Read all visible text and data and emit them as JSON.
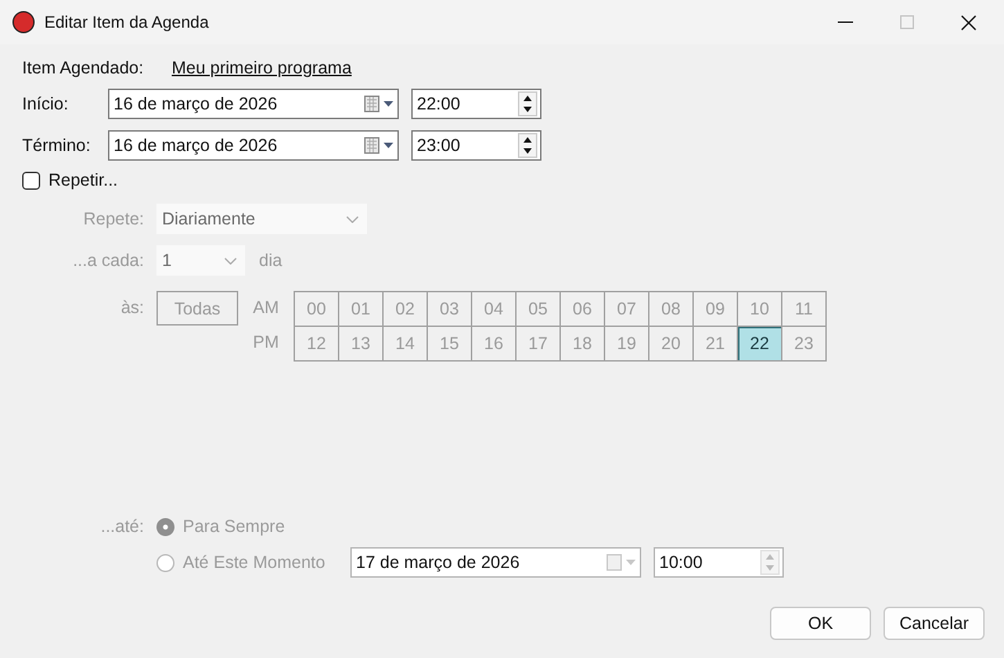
{
  "window": {
    "title": "Editar Item da Agenda",
    "maximize_enabled": false
  },
  "item": {
    "label": "Item Agendado:",
    "link": "Meu primeiro programa"
  },
  "start": {
    "label": "Início:",
    "date": "16 de março de 2026",
    "time": "22:00"
  },
  "end": {
    "label": "Término:",
    "date": "16 de março de 2026",
    "time": "23:00"
  },
  "repeat": {
    "label": "Repetir...",
    "checked": false
  },
  "repeat_mode": {
    "label": "Repete:",
    "value": "Diariamente"
  },
  "interval": {
    "label": "...a cada:",
    "value": "1",
    "unit": "dia"
  },
  "at": {
    "label": "às:",
    "all_button": "Todas",
    "rows": [
      {
        "label": "AM",
        "hours": [
          {
            "label": "00",
            "selected": false
          },
          {
            "label": "01",
            "selected": false
          },
          {
            "label": "02",
            "selected": false
          },
          {
            "label": "03",
            "selected": false
          },
          {
            "label": "04",
            "selected": false
          },
          {
            "label": "05",
            "selected": false
          },
          {
            "label": "06",
            "selected": false
          },
          {
            "label": "07",
            "selected": false
          },
          {
            "label": "08",
            "selected": false
          },
          {
            "label": "09",
            "selected": false
          },
          {
            "label": "10",
            "selected": false
          },
          {
            "label": "11",
            "selected": false
          }
        ]
      },
      {
        "label": "PM",
        "hours": [
          {
            "label": "12",
            "selected": false
          },
          {
            "label": "13",
            "selected": false
          },
          {
            "label": "14",
            "selected": false
          },
          {
            "label": "15",
            "selected": false
          },
          {
            "label": "16",
            "selected": false
          },
          {
            "label": "17",
            "selected": false
          },
          {
            "label": "18",
            "selected": false
          },
          {
            "label": "19",
            "selected": false
          },
          {
            "label": "20",
            "selected": false
          },
          {
            "label": "21",
            "selected": false
          },
          {
            "label": "22",
            "selected": true
          },
          {
            "label": "23",
            "selected": false
          }
        ]
      }
    ]
  },
  "until": {
    "label": "...até:",
    "options": [
      {
        "label": "Para Sempre",
        "selected": true
      },
      {
        "label": "Até Este Momento",
        "selected": false
      }
    ],
    "date": "17 de março de 2026",
    "time": "10:00"
  },
  "buttons": [
    "OK",
    "Cancelar"
  ]
}
